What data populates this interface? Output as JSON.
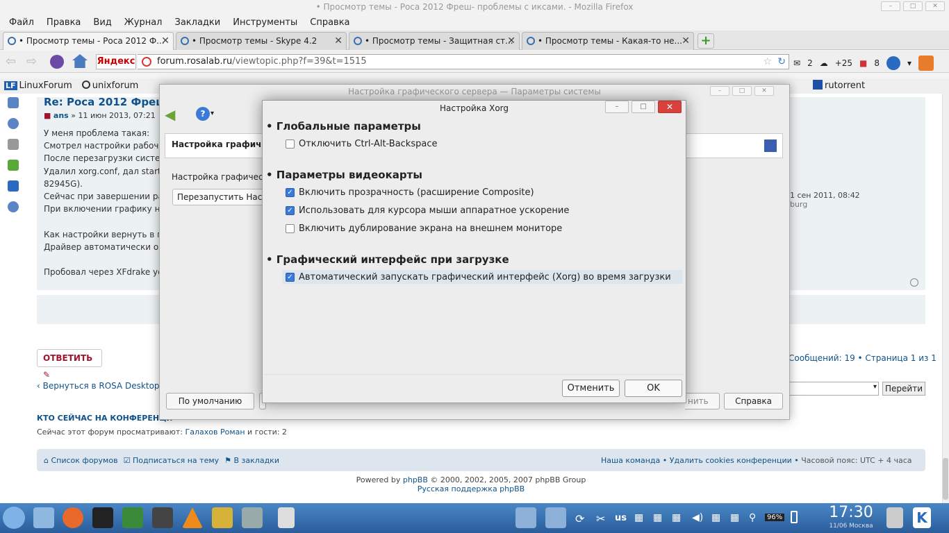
{
  "window": {
    "title": "• Просмотр темы - Роса 2012 Фреш- проблемы с иксами. - Mozilla Firefox",
    "controls": [
      "–",
      "□",
      "✕"
    ]
  },
  "menu": [
    "Файл",
    "Правка",
    "Вид",
    "Журнал",
    "Закладки",
    "Инструменты",
    "Справка"
  ],
  "tabs": [
    {
      "label": "• Просмотр темы - Роса 2012 Ф...",
      "active": true
    },
    {
      "label": "• Просмотр темы - Skype 4.2",
      "active": false
    },
    {
      "label": "• Просмотр темы - Защитная ст...",
      "active": false
    },
    {
      "label": "• Просмотр темы - Какая-то не...",
      "active": false
    }
  ],
  "newtab_label": "+",
  "navbar": {
    "back": "⇦",
    "forward": "⇨",
    "yandex": "Яндекс",
    "url_domain": "forum.rosalab.ru",
    "url_path": "/viewtopic.php?f=39&t=1515",
    "mail_count": "2",
    "weather": "+25",
    "badge_count": "8"
  },
  "bookmarks": [
    "LinuxForum",
    "unixforum",
    "rutorrent"
  ],
  "bookmark_lf_badge": "LF",
  "post": {
    "title": "Re: Роса 2012 Фреш- п",
    "author": "ans",
    "date": "» 11 июн 2013, 07:21",
    "lines": [
      "У меня проблема такая:",
      "Смотрел настройки рабочег",
      "После перезагрузки систем",
      "Удалил xorg.conf, дал start",
      "82945G).",
      "Сейчас при завершении раб",
      "При включении графику не",
      "",
      "Как настройки вернуть в пе",
      "Драйвер автоматически опр",
      "",
      "Пробовал через XFdrake уст"
    ],
    "profile_date": "11 сен 2011, 08:42",
    "profile_city": "nburg"
  },
  "reply_button": "ОТВЕТИТЬ",
  "pagination": "Сообщений: 19 • Страница 1 из 1",
  "back_link": "Вернуться в ROSA Desktop",
  "jump_button": "Перейти",
  "online": {
    "heading": "КТО СЕЙЧАС НА КОНФЕРЕНЦИ",
    "prefix": "Сейчас этот форум просматривают: ",
    "user": "Галахов Роман",
    "suffix": " и гости: 2"
  },
  "footer": {
    "forums": "Список форумов",
    "subscribe": "Подписаться на тему",
    "bookmark": "В закладки",
    "team": "Наша команда",
    "cookies": "Удалить cookies конференции",
    "timezone": "Часовой пояс: UTC + 4 часа"
  },
  "powered": {
    "prefix": "Powered by ",
    "link": "phpBB",
    "suffix": " © 2000, 2002, 2005, 2007 phpBB Group",
    "support": "Русская поддержка phpBB"
  },
  "bg_dialog": {
    "title": "Настройка графического сервера — Параметры системы",
    "header": "Настройка графичес",
    "label": "Настройка графическ",
    "restart": "Перезапустить Наст",
    "default_button": "По умолчанию",
    "apply_button": "нить",
    "help_button": "Справка"
  },
  "xorg": {
    "title": "Настройка Xorg",
    "sections": [
      {
        "title": "• Глобальные параметры"
      },
      {
        "title": "• Параметры видеокарты"
      },
      {
        "title": "• Графический интерфейс при загрузке"
      }
    ],
    "options": [
      {
        "label": "Отключить Ctrl-Alt-Backspace",
        "checked": false
      },
      {
        "label": "Включить прозрачность (расширение Composite)",
        "checked": true
      },
      {
        "label": "Использовать для курсора мыши аппаратное ускорение",
        "checked": true
      },
      {
        "label": "Включить дублирование экрана на внешнем мониторе",
        "checked": false
      },
      {
        "label": "Автоматический запускать графический интерфейс (Xorg) во время загрузки",
        "checked": true
      }
    ],
    "cancel": "Отменить",
    "ok": "OK"
  },
  "taskbar": {
    "lang": "us",
    "battery": "96%",
    "time": "17:30",
    "date": "11/06 Москва"
  }
}
